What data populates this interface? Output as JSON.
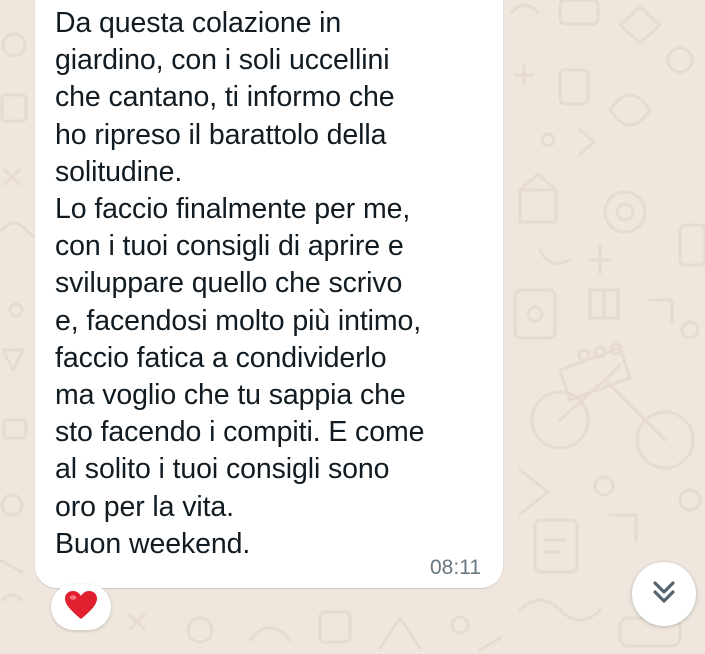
{
  "message": {
    "text": "Da questa colazione in\ngiardino, con i soli uccellini\nche cantano, ti informo che\nho ripreso il barattolo della\nsolitudine.\nLo faccio finalmente per me,\ncon i tuoi consigli di aprire e\nsviluppare quello che scrivo\ne, facendosi molto più intimo,\nfaccio fatica a condividerlo\nma voglio che tu sappia che\nsto facendo i compiti. E come\nal solito i tuoi consigli sono\noro per la vita.\nBuon weekend.",
    "time": "08:11",
    "reaction_icon": "red-heart-icon"
  },
  "scroll_button": {
    "icon": "double-chevron-down-icon"
  },
  "colors": {
    "background": "#efe7de",
    "bubble": "#ffffff",
    "text": "#111b21",
    "timestamp": "#667781",
    "heart": "#e0202e",
    "chevron": "#54656f",
    "wallpaper_doodle": "#e6dbce"
  }
}
